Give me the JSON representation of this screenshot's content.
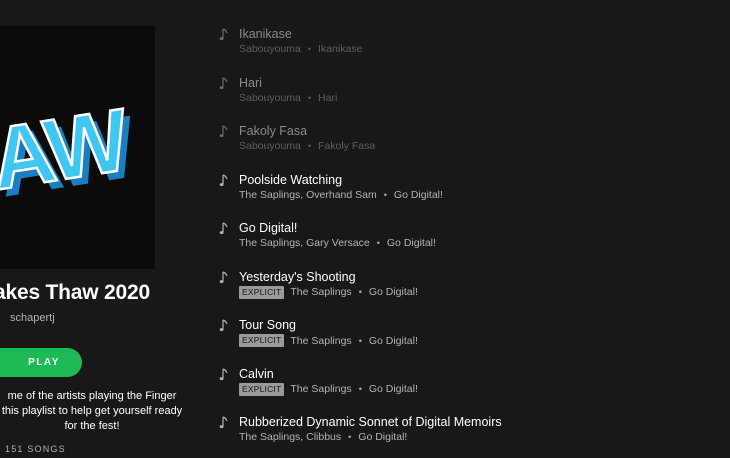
{
  "playlist": {
    "cover_text": "AW",
    "title": "akes Thaw 2020",
    "owner": "schapertj",
    "play_label": "PLAY",
    "description_lines": [
      "me of the artists playing the Finger",
      "this playlist to help get yourself ready",
      "for the fest!"
    ],
    "song_count": "151 SONGS"
  },
  "colors": {
    "background": "#181818",
    "accent": "#1db954",
    "cover_letters": "#3fc6f3",
    "cover_shadow": "#1a7fc0"
  },
  "icons": {
    "track": "music-note-icon"
  },
  "tracks": [
    {
      "name": "Ikanikase",
      "artists": "Sabouyouma",
      "album": "Ikanikase",
      "explicit": false,
      "dim": true
    },
    {
      "name": "Hari",
      "artists": "Sabouyouma",
      "album": "Hari",
      "explicit": false,
      "dim": true
    },
    {
      "name": "Fakoly Fasa",
      "artists": "Sabouyouma",
      "album": "Fakoly Fasa",
      "explicit": false,
      "dim": true
    },
    {
      "name": "Poolside Watching",
      "artists": "The Saplings, Overhand Sam",
      "album": "Go Digital!",
      "explicit": false,
      "dim": false
    },
    {
      "name": "Go Digital!",
      "artists": "The Saplings, Gary Versace",
      "album": "Go Digital!",
      "explicit": false,
      "dim": false
    },
    {
      "name": "Yesterday's Shooting",
      "artists": "The Saplings",
      "album": "Go Digital!",
      "explicit": true,
      "dim": false
    },
    {
      "name": "Tour Song",
      "artists": "The Saplings",
      "album": "Go Digital!",
      "explicit": true,
      "dim": false
    },
    {
      "name": "Calvin",
      "artists": "The Saplings",
      "album": "Go Digital!",
      "explicit": true,
      "dim": false
    },
    {
      "name": "Rubberized Dynamic Sonnet of Digital Memoirs",
      "artists": "The Saplings, Clibbus",
      "album": "Go Digital!",
      "explicit": false,
      "dim": false
    }
  ],
  "labels": {
    "explicit": "EXPLICIT",
    "separator": "•"
  }
}
